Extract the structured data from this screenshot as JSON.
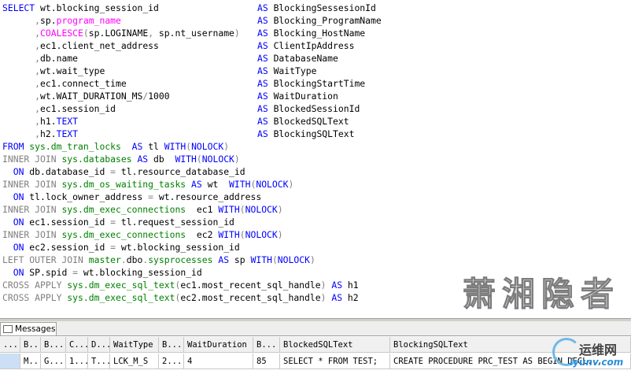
{
  "editor": {
    "lines": [
      [
        {
          "t": "SELECT ",
          "c": "kw"
        },
        {
          "t": "wt.blocking_session_id",
          "c": "txt"
        },
        {
          "alias": "BlockingSessesionId"
        }
      ],
      [
        {
          "t": "      ,",
          "c": "gray"
        },
        {
          "t": "sp.",
          "c": "txt"
        },
        {
          "t": "program_name",
          "c": "fn"
        },
        {
          "alias": "Blocking_ProgramName"
        }
      ],
      [
        {
          "t": "      ,",
          "c": "gray"
        },
        {
          "t": "COALESCE",
          "c": "fn"
        },
        {
          "t": "(",
          "c": "gray"
        },
        {
          "t": "sp.LOGINAME",
          "c": "txt"
        },
        {
          "t": ", ",
          "c": "gray"
        },
        {
          "t": "sp.nt_username",
          "c": "txt"
        },
        {
          "t": ")",
          "c": "gray"
        },
        {
          "alias": "Blocking_HostName"
        }
      ],
      [
        {
          "t": "      ,",
          "c": "gray"
        },
        {
          "t": "ec1.client_net_address",
          "c": "txt"
        },
        {
          "alias": "ClientIpAddress"
        }
      ],
      [
        {
          "t": "      ,",
          "c": "gray"
        },
        {
          "t": "db.name",
          "c": "txt"
        },
        {
          "alias": "DatabaseName"
        }
      ],
      [
        {
          "t": "      ,",
          "c": "gray"
        },
        {
          "t": "wt.wait_type",
          "c": "txt"
        },
        {
          "alias": "WaitType"
        }
      ],
      [
        {
          "t": "      ,",
          "c": "gray"
        },
        {
          "t": "ec1.connect_time",
          "c": "txt"
        },
        {
          "alias": "BlockingStartTime"
        }
      ],
      [
        {
          "t": "      ,",
          "c": "gray"
        },
        {
          "t": "wt.WAIT_DURATION_MS",
          "c": "txt"
        },
        {
          "t": "/",
          "c": "gray"
        },
        {
          "t": "1000",
          "c": "txt"
        },
        {
          "alias": "WaitDuration"
        }
      ],
      [
        {
          "t": "      ,",
          "c": "gray"
        },
        {
          "t": "ec1.session_id",
          "c": "txt"
        },
        {
          "alias": "BlockedSessionId"
        }
      ],
      [
        {
          "t": "      ,",
          "c": "gray"
        },
        {
          "t": "h1.",
          "c": "txt"
        },
        {
          "t": "TEXT",
          "c": "kw"
        },
        {
          "alias": "BlockedSQLText"
        }
      ],
      [
        {
          "t": "      ,",
          "c": "gray"
        },
        {
          "t": "h2.",
          "c": "txt"
        },
        {
          "t": "TEXT",
          "c": "kw"
        },
        {
          "alias": "BlockingSQLText"
        }
      ],
      [
        {
          "t": "FROM ",
          "c": "kw"
        },
        {
          "t": "sys.dm_tran_locks",
          "c": "sys"
        },
        {
          "t": "  ",
          "c": "txt"
        },
        {
          "t": "AS ",
          "c": "kw"
        },
        {
          "t": "tl ",
          "c": "txt"
        },
        {
          "t": "WITH",
          "c": "kw"
        },
        {
          "t": "(",
          "c": "gray"
        },
        {
          "t": "NOLOCK",
          "c": "kw"
        },
        {
          "t": ")",
          "c": "gray"
        }
      ],
      [
        {
          "t": "INNER JOIN ",
          "c": "gray"
        },
        {
          "t": "sys.databases",
          "c": "sys"
        },
        {
          "t": " ",
          "c": "txt"
        },
        {
          "t": "AS ",
          "c": "kw"
        },
        {
          "t": "db  ",
          "c": "txt"
        },
        {
          "t": "WITH",
          "c": "kw"
        },
        {
          "t": "(",
          "c": "gray"
        },
        {
          "t": "NOLOCK",
          "c": "kw"
        },
        {
          "t": ")",
          "c": "gray"
        }
      ],
      [
        {
          "t": "  ON ",
          "c": "kw"
        },
        {
          "t": "db.database_id ",
          "c": "txt"
        },
        {
          "t": "= ",
          "c": "gray"
        },
        {
          "t": "tl.resource_database_id",
          "c": "txt"
        }
      ],
      [
        {
          "t": "INNER JOIN ",
          "c": "gray"
        },
        {
          "t": "sys.dm_os_waiting_tasks",
          "c": "sys"
        },
        {
          "t": " ",
          "c": "txt"
        },
        {
          "t": "AS ",
          "c": "kw"
        },
        {
          "t": "wt  ",
          "c": "txt"
        },
        {
          "t": "WITH",
          "c": "kw"
        },
        {
          "t": "(",
          "c": "gray"
        },
        {
          "t": "NOLOCK",
          "c": "kw"
        },
        {
          "t": ")",
          "c": "gray"
        }
      ],
      [
        {
          "t": "  ON ",
          "c": "kw"
        },
        {
          "t": "tl.lock_owner_address ",
          "c": "txt"
        },
        {
          "t": "= ",
          "c": "gray"
        },
        {
          "t": "wt.resource_address",
          "c": "txt"
        }
      ],
      [
        {
          "t": "INNER JOIN ",
          "c": "gray"
        },
        {
          "t": "sys.dm_exec_connections",
          "c": "sys"
        },
        {
          "t": "  ec1 ",
          "c": "txt"
        },
        {
          "t": "WITH",
          "c": "kw"
        },
        {
          "t": "(",
          "c": "gray"
        },
        {
          "t": "NOLOCK",
          "c": "kw"
        },
        {
          "t": ")",
          "c": "gray"
        }
      ],
      [
        {
          "t": "  ON ",
          "c": "kw"
        },
        {
          "t": "ec1.session_id ",
          "c": "txt"
        },
        {
          "t": "= ",
          "c": "gray"
        },
        {
          "t": "tl.request_session_id",
          "c": "txt"
        }
      ],
      [
        {
          "t": "INNER JOIN ",
          "c": "gray"
        },
        {
          "t": "sys.dm_exec_connections",
          "c": "sys"
        },
        {
          "t": "  ec2 ",
          "c": "txt"
        },
        {
          "t": "WITH",
          "c": "kw"
        },
        {
          "t": "(",
          "c": "gray"
        },
        {
          "t": "NOLOCK",
          "c": "kw"
        },
        {
          "t": ")",
          "c": "gray"
        }
      ],
      [
        {
          "t": "  ON ",
          "c": "kw"
        },
        {
          "t": "ec2.session_id ",
          "c": "txt"
        },
        {
          "t": "= ",
          "c": "gray"
        },
        {
          "t": "wt.blocking_session_id",
          "c": "txt"
        }
      ],
      [
        {
          "t": "LEFT OUTER JOIN ",
          "c": "gray"
        },
        {
          "t": "master",
          "c": "sys"
        },
        {
          "t": ".",
          "c": "gray"
        },
        {
          "t": "dbo",
          "c": "txt"
        },
        {
          "t": ".",
          "c": "gray"
        },
        {
          "t": "sysprocesses",
          "c": "sys"
        },
        {
          "t": " ",
          "c": "txt"
        },
        {
          "t": "AS ",
          "c": "kw"
        },
        {
          "t": "sp ",
          "c": "txt"
        },
        {
          "t": "WITH",
          "c": "kw"
        },
        {
          "t": "(",
          "c": "gray"
        },
        {
          "t": "NOLOCK",
          "c": "kw"
        },
        {
          "t": ")",
          "c": "gray"
        }
      ],
      [
        {
          "t": "  ON ",
          "c": "kw"
        },
        {
          "t": "SP.spid ",
          "c": "txt"
        },
        {
          "t": "= ",
          "c": "gray"
        },
        {
          "t": "wt.blocking_session_id",
          "c": "txt"
        }
      ],
      [
        {
          "t": "CROSS APPLY ",
          "c": "gray"
        },
        {
          "t": "sys.dm_exec_sql_text",
          "c": "sys"
        },
        {
          "t": "(",
          "c": "gray"
        },
        {
          "t": "ec1.most_recent_sql_handle",
          "c": "txt"
        },
        {
          "t": ") ",
          "c": "gray"
        },
        {
          "t": "AS ",
          "c": "kw"
        },
        {
          "t": "h1",
          "c": "txt"
        }
      ],
      [
        {
          "t": "CROSS APPLY ",
          "c": "gray"
        },
        {
          "t": "sys.dm_exec_sql_text",
          "c": "sys"
        },
        {
          "t": "(",
          "c": "gray"
        },
        {
          "t": "ec2.most_recent_sql_handle",
          "c": "txt"
        },
        {
          "t": ") ",
          "c": "gray"
        },
        {
          "t": "AS ",
          "c": "kw"
        },
        {
          "t": "h2",
          "c": "txt"
        }
      ]
    ],
    "alias_keyword": "AS"
  },
  "watermark": "萧湘隐者",
  "results": {
    "tab_label": "Messages",
    "columns": [
      {
        "label": "...",
        "w": 26
      },
      {
        "label": "B...",
        "w": 26
      },
      {
        "label": "B...",
        "w": 32
      },
      {
        "label": "C...",
        "w": 28
      },
      {
        "label": "D...",
        "w": 28
      },
      {
        "label": "WaitType",
        "w": 62
      },
      {
        "label": "B...",
        "w": 32
      },
      {
        "label": "WaitDuration",
        "w": 88
      },
      {
        "label": "B...",
        "w": 34
      },
      {
        "label": "BlockedSQLText",
        "w": 140
      },
      {
        "label": "BlockingSQLText",
        "w": 306
      }
    ],
    "row": [
      "",
      "M...",
      "G...",
      "1...",
      "T...",
      "LCK_M_S",
      "2...",
      "4",
      "85",
      "SELECT * FROM TEST;",
      "CREATE PROCEDURE PRC_TEST  AS   BEGIN   DECL..."
    ]
  },
  "logo": {
    "cn": "运维网",
    "en": "iyunv.com"
  },
  "colors": {
    "keyword": "#0000ff",
    "function": "#ff00ff",
    "system": "#008000",
    "operator": "#808080",
    "selection": "#cce0f5"
  }
}
